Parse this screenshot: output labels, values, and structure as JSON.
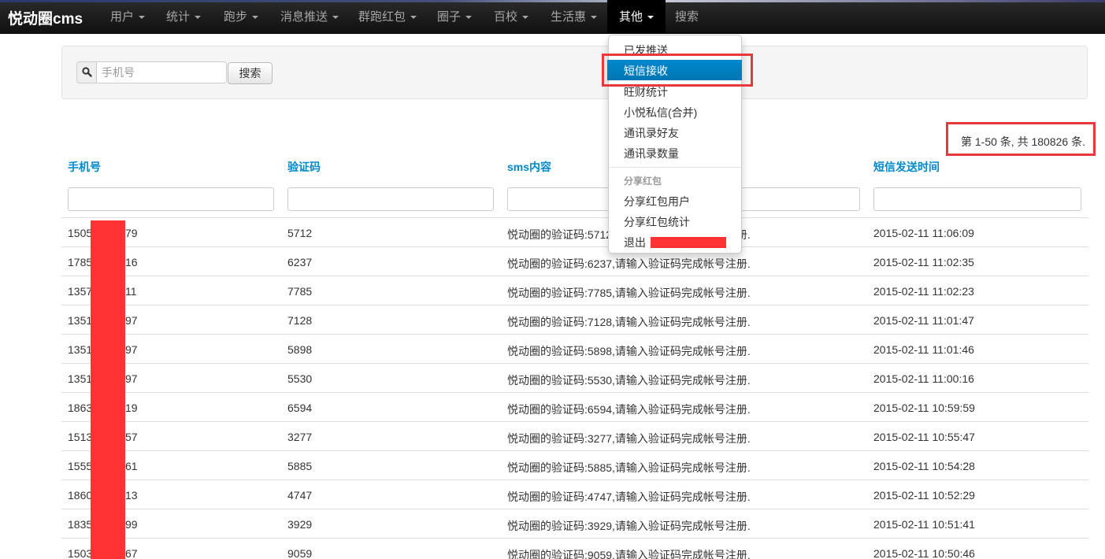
{
  "nav": {
    "brand": "悦动圈cms",
    "items": [
      {
        "label": "用户"
      },
      {
        "label": "统计"
      },
      {
        "label": "跑步"
      },
      {
        "label": "消息推送"
      },
      {
        "label": "群跑红包"
      },
      {
        "label": "圈子"
      },
      {
        "label": "百校"
      },
      {
        "label": "生活惠"
      },
      {
        "label": "其他",
        "active": true
      }
    ],
    "search_label": "搜索"
  },
  "search": {
    "placeholder": "手机号",
    "button_label": "搜索"
  },
  "dropdown": {
    "items": [
      "已发推送",
      "短信接收",
      "旺财统计",
      "小悦私信(合并)",
      "通讯录好友",
      "通讯录数量"
    ],
    "active_item": "短信接收",
    "section_header": "分享红包",
    "section_items": [
      "分享红包用户",
      "分享红包统计",
      "退出"
    ]
  },
  "pagination_info": "第 1-50 条, 共 180826 条.",
  "table": {
    "columns": [
      "手机号",
      "验证码",
      "sms内容",
      "短信发送时间"
    ],
    "rows": [
      {
        "phone_prefix": "1505",
        "phone_suffix": "79",
        "code": "5712",
        "content": "悦动圈的验证码:5712,请输入验证码完成帐号注册.",
        "time": "2015-02-11 11:06:09"
      },
      {
        "phone_prefix": "1785",
        "phone_suffix": "16",
        "code": "6237",
        "content": "悦动圈的验证码:6237,请输入验证码完成帐号注册.",
        "time": "2015-02-11 11:02:35"
      },
      {
        "phone_prefix": "1357",
        "phone_suffix": "11",
        "code": "7785",
        "content": "悦动圈的验证码:7785,请输入验证码完成帐号注册.",
        "time": "2015-02-11 11:02:23"
      },
      {
        "phone_prefix": "1351",
        "phone_suffix": "97",
        "code": "7128",
        "content": "悦动圈的验证码:7128,请输入验证码完成帐号注册.",
        "time": "2015-02-11 11:01:47"
      },
      {
        "phone_prefix": "1351",
        "phone_suffix": "97",
        "code": "5898",
        "content": "悦动圈的验证码:5898,请输入验证码完成帐号注册.",
        "time": "2015-02-11 11:01:46"
      },
      {
        "phone_prefix": "1351",
        "phone_suffix": "97",
        "code": "5530",
        "content": "悦动圈的验证码:5530,请输入验证码完成帐号注册.",
        "time": "2015-02-11 11:00:16"
      },
      {
        "phone_prefix": "1863",
        "phone_suffix": "19",
        "code": "6594",
        "content": "悦动圈的验证码:6594,请输入验证码完成帐号注册.",
        "time": "2015-02-11 10:59:59"
      },
      {
        "phone_prefix": "1513",
        "phone_suffix": "57",
        "code": "3277",
        "content": "悦动圈的验证码:3277,请输入验证码完成帐号注册.",
        "time": "2015-02-11 10:55:47"
      },
      {
        "phone_prefix": "1555",
        "phone_suffix": "61",
        "code": "5885",
        "content": "悦动圈的验证码:5885,请输入验证码完成帐号注册.",
        "time": "2015-02-11 10:54:28"
      },
      {
        "phone_prefix": "1860",
        "phone_suffix": "13",
        "code": "4747",
        "content": "悦动圈的验证码:4747,请输入验证码完成帐号注册.",
        "time": "2015-02-11 10:52:29"
      },
      {
        "phone_prefix": "1835",
        "phone_suffix": "99",
        "code": "3929",
        "content": "悦动圈的验证码:3929,请输入验证码完成帐号注册.",
        "time": "2015-02-11 10:51:41"
      },
      {
        "phone_prefix": "1503",
        "phone_suffix": "67",
        "code": "9059",
        "content": "悦动圈的验证码:9059,请输入验证码完成帐号注册.",
        "time": "2015-02-11 10:50:46"
      }
    ]
  },
  "colors": {
    "navbar": "#1b1b1b",
    "link": "#0088cc",
    "highlight": "#e8383d",
    "redaction": "#ff3333",
    "dropdown_active": "#0081c2"
  },
  "icons": {
    "search_addon": "search-icon",
    "nav_caret": "caret-down-icon"
  }
}
